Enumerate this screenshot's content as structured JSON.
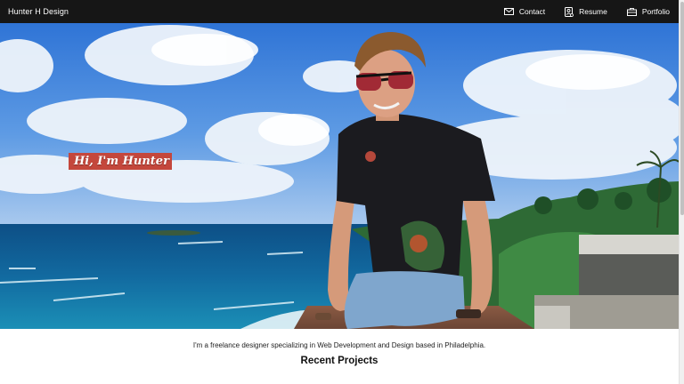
{
  "brand": {
    "name": "Hunter H Design"
  },
  "nav": {
    "items": [
      {
        "label": "Contact",
        "icon": "envelope-icon"
      },
      {
        "label": "Resume",
        "icon": "document-person-icon"
      },
      {
        "label": "Portfolio",
        "icon": "briefcase-icon"
      }
    ]
  },
  "hero": {
    "greeting": "Hi, I'm Hunter",
    "greeting_bg_color": "#c4473c",
    "image_description_icon": "hero-photo"
  },
  "main": {
    "intro": "I'm a freelance designer specializing in Web Development and Design based in Philadelphia.",
    "section_title": "Recent Projects"
  },
  "colors": {
    "navbar": "#161616",
    "page_bg": "#ffffff"
  }
}
